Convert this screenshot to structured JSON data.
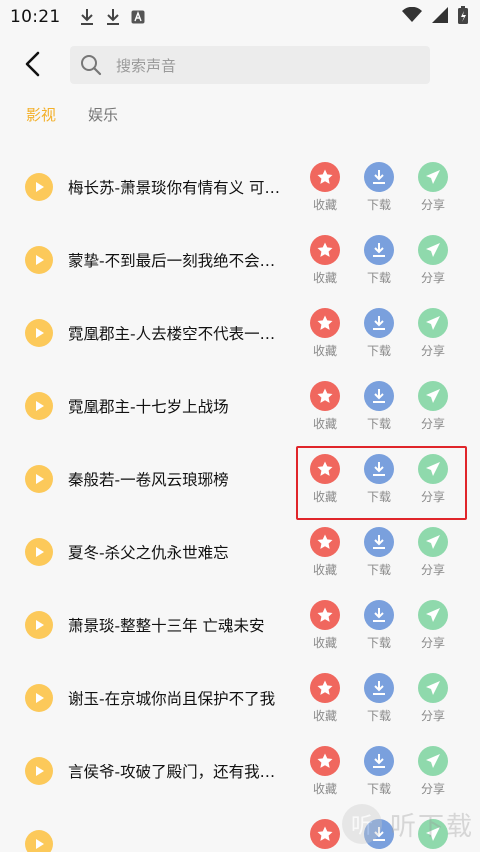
{
  "status_bar": {
    "time": "10:21"
  },
  "search": {
    "placeholder": "搜索声音"
  },
  "tabs": [
    {
      "label": "影视",
      "active": true
    },
    {
      "label": "娱乐",
      "active": false
    }
  ],
  "actions": {
    "favorite": "收藏",
    "download": "下载",
    "share": "分享"
  },
  "items": [
    {
      "title": "梅长苏-萧景琰你有情有义 可…"
    },
    {
      "title": "蒙挚-不到最后一刻我绝不会…"
    },
    {
      "title": "霓凰郡主-人去楼空不代表一…"
    },
    {
      "title": "霓凰郡主-十七岁上战场"
    },
    {
      "title": "秦般若-一卷风云琅琊榜"
    },
    {
      "title": "夏冬-杀父之仇永世难忘"
    },
    {
      "title": "萧景琰-整整十三年 亡魂未安"
    },
    {
      "title": "谢玉-在京城你尚且保护不了我"
    },
    {
      "title": "言侯爷-攻破了殿门，还有我…"
    },
    {
      "title": ""
    }
  ],
  "watermark": {
    "text": "听下载",
    "logo_glyph": "听"
  },
  "colors": {
    "accent": "#f3b02a",
    "play": "#fcc95a",
    "favorite": "#f0675e",
    "download": "#7aa0dd",
    "share": "#8fd9ac",
    "highlight": "#e0252a"
  }
}
